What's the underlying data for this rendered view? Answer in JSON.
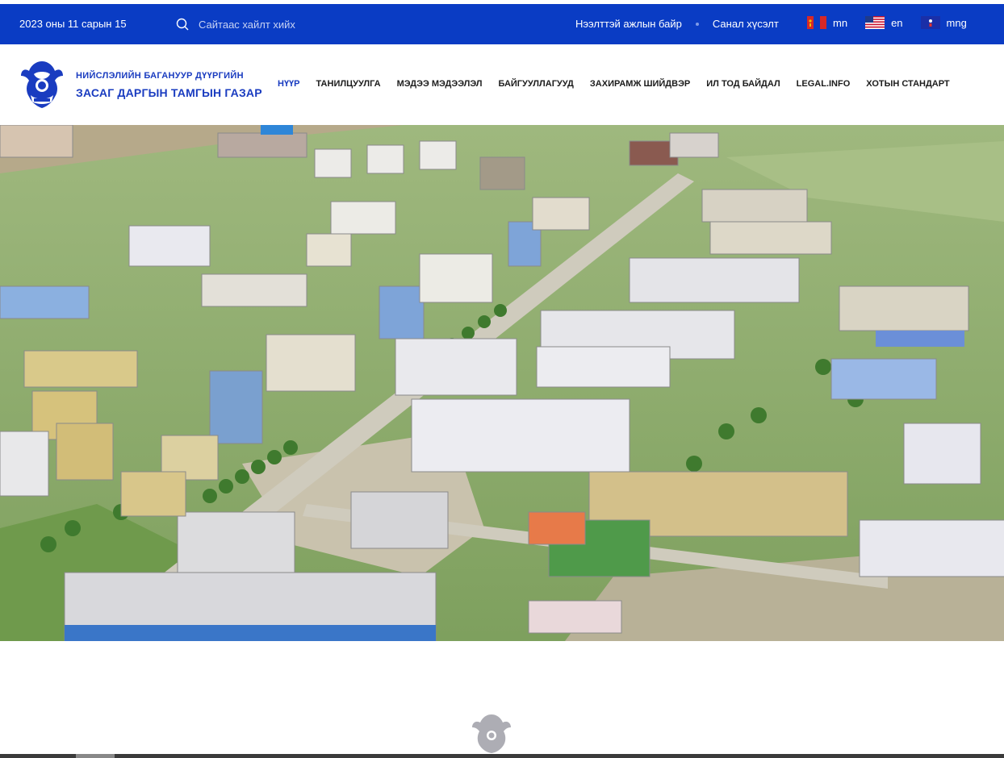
{
  "topbar": {
    "date": "2023 оны 11 сарын 15",
    "search_placeholder": "Сайтаас хайлт хийх",
    "links": [
      "Нээлттэй ажлын байр",
      "Санал хүсэлт"
    ],
    "languages": [
      {
        "code": "mn",
        "flag": "mongolia-flag-icon"
      },
      {
        "code": "en",
        "flag": "usa-flag-icon"
      },
      {
        "code": "mng",
        "flag": "mongolian-script-flag-icon"
      }
    ]
  },
  "logo": {
    "line1": "НИЙСЛЭЛИЙН БАГАНУУР ДҮҮРГИЙН",
    "line2": "ЗАСАГ ДАРГЫН ТАМГЫН ГАЗАР",
    "emblem": "eagle-emblem-icon"
  },
  "nav": {
    "items": [
      {
        "label": "НҮҮР",
        "active": true
      },
      {
        "label": "ТАНИЛЦУУЛГА",
        "active": false
      },
      {
        "label": "МЭДЭЭ МЭДЭЭЛЭЛ",
        "active": false
      },
      {
        "label": "БАЙГУУЛЛАГУУД",
        "active": false
      },
      {
        "label": "ЗАХИРАМЖ ШИЙДВЭР",
        "active": false
      },
      {
        "label": "ИЛ ТОД БАЙДАЛ",
        "active": false
      },
      {
        "label": "LEGAL.INFO",
        "active": false
      },
      {
        "label": "ХОТЫН СТАНДАРТ",
        "active": false
      }
    ]
  },
  "hero": {
    "image": "aerial-city-photo"
  },
  "colors": {
    "primary": "#0a3cc4",
    "accent_text": "#1a3cc0"
  }
}
